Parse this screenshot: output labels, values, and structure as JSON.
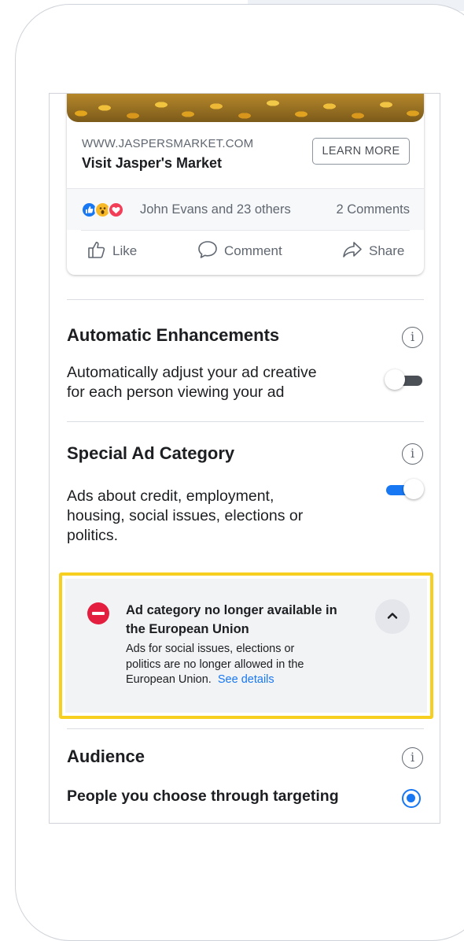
{
  "ad_preview": {
    "url": "WWW.JASPERSMARKET.COM",
    "title": "Visit Jasper's Market",
    "cta_label": "LEARN MORE",
    "reactions_text": "John Evans and 23 others",
    "comments_text": "2 Comments",
    "actions": {
      "like": "Like",
      "comment": "Comment",
      "share": "Share"
    }
  },
  "automatic_enhancements": {
    "title": "Automatic Enhancements",
    "description_line1": "Automatically adjust your ad creative",
    "description_line2": "for each person viewing your ad",
    "enabled": false
  },
  "special_ad_category": {
    "title": "Special Ad Category",
    "description_line1": "Ads about credit, employment,",
    "description_line2": "housing, social issues, elections or",
    "description_line3": "politics.",
    "enabled": true
  },
  "warning": {
    "title_line1": "Ad category no longer available in",
    "title_line2": "the European Union",
    "body_line1": "Ads for social issues, elections or",
    "body_line2": "politics are no longer allowed in the",
    "body_line3": "European Union.",
    "link_text": "See details"
  },
  "audience": {
    "title": "Audience",
    "option_label": "People you choose through targeting",
    "option_selected": true
  },
  "colors": {
    "accent": "#1877f2",
    "warning_border": "#f7cf1e",
    "error": "#e41e3f"
  }
}
